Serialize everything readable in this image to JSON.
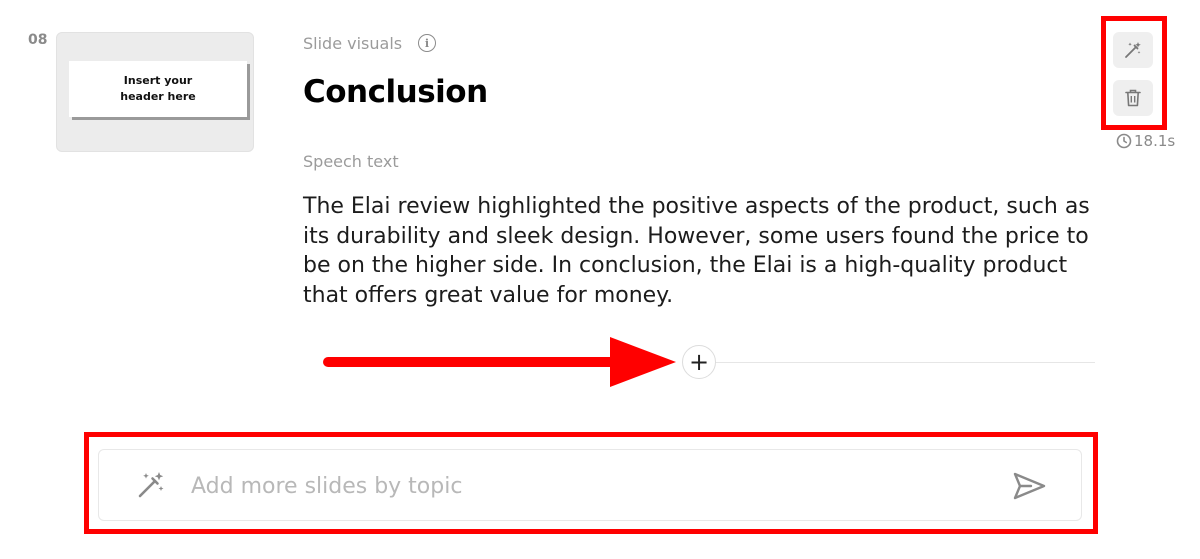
{
  "slide": {
    "number": "08",
    "thumbnail_text": "Insert your\nheader here",
    "visuals_label": "Slide visuals",
    "title": "Conclusion",
    "speech_label": "Speech text",
    "speech_text": "The Elai review highlighted the positive aspects of the product, such as its durability and sleek design. However, some users found the price to be on the higher side. In conclusion, the Elai is a high-quality product that offers great value for money.",
    "duration": "18.1s",
    "add_button_symbol": "+"
  },
  "prompt": {
    "placeholder": "Add more slides by topic",
    "value": ""
  },
  "icons": {
    "info": "info-icon",
    "magic": "magic-wand-icon",
    "trash": "trash-icon",
    "clock": "clock-icon",
    "send": "send-icon",
    "plus": "plus-icon"
  },
  "colors": {
    "annotation": "#ff0000",
    "text_primary": "#000000",
    "text_muted": "#9b9b9b"
  }
}
